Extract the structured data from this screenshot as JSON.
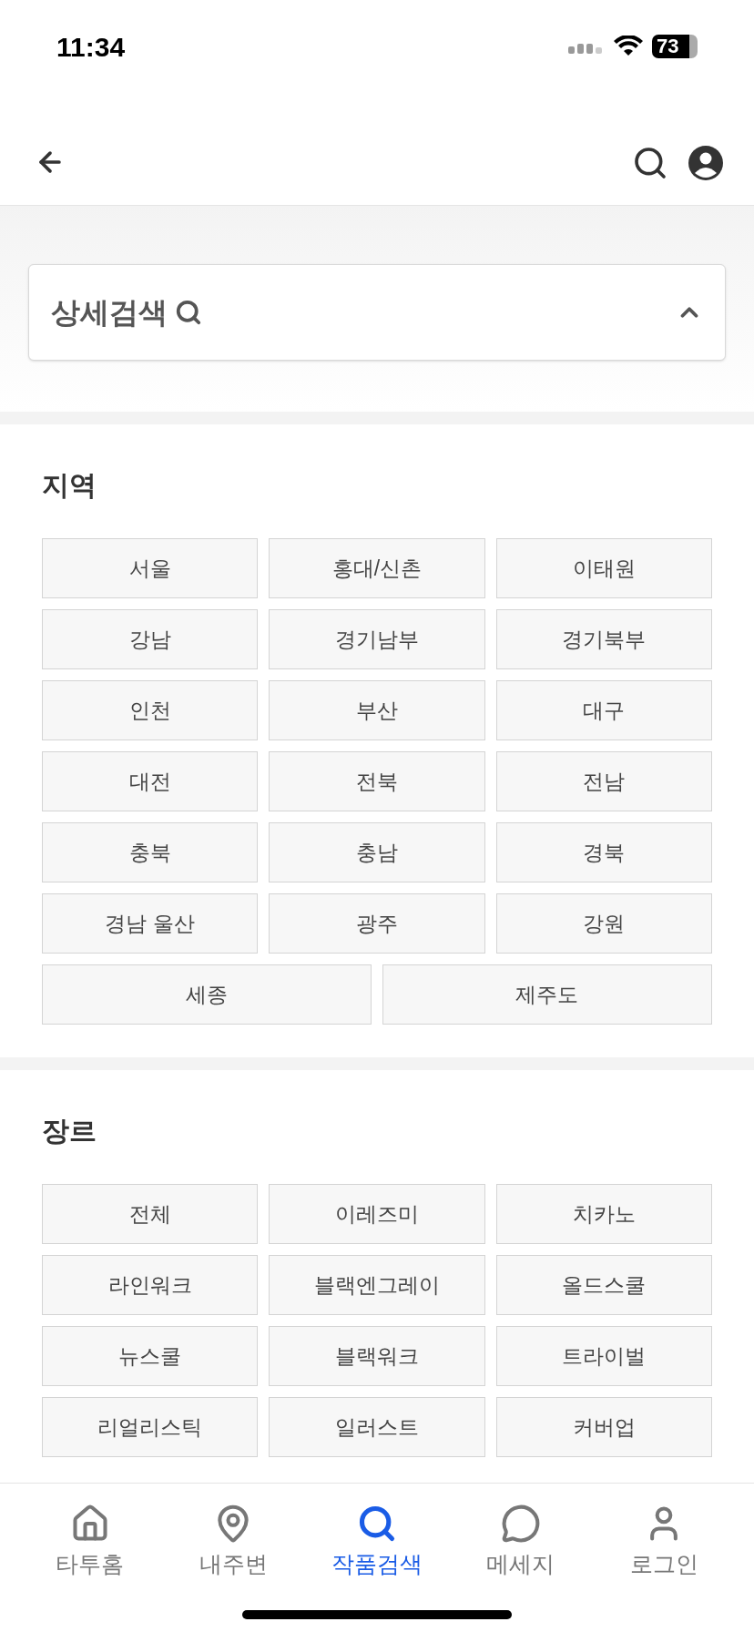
{
  "status_bar": {
    "time": "11:34",
    "battery": "73"
  },
  "filter_card": {
    "title": "상세검색",
    "expanded": true
  },
  "sections": [
    {
      "title": "지역",
      "options": [
        {
          "label": "서울",
          "selected": false
        },
        {
          "label": "홍대/신촌",
          "selected": false
        },
        {
          "label": "이태원",
          "selected": false
        },
        {
          "label": "강남",
          "selected": false
        },
        {
          "label": "경기남부",
          "selected": false
        },
        {
          "label": "경기북부",
          "selected": false
        },
        {
          "label": "인천",
          "selected": false
        },
        {
          "label": "부산",
          "selected": false
        },
        {
          "label": "대구",
          "selected": false
        },
        {
          "label": "대전",
          "selected": false
        },
        {
          "label": "전북",
          "selected": false
        },
        {
          "label": "전남",
          "selected": false
        },
        {
          "label": "충북",
          "selected": false
        },
        {
          "label": "충남",
          "selected": false
        },
        {
          "label": "경북",
          "selected": false
        },
        {
          "label": "경남 울산",
          "selected": false
        },
        {
          "label": "광주",
          "selected": false
        },
        {
          "label": "강원",
          "selected": false
        },
        {
          "label": "세종",
          "selected": false,
          "wide": true
        },
        {
          "label": "제주도",
          "selected": false,
          "wide": true
        }
      ]
    },
    {
      "title": "장르",
      "options": [
        {
          "label": "전체",
          "selected": false
        },
        {
          "label": "이레즈미",
          "selected": false
        },
        {
          "label": "치카노",
          "selected": false
        },
        {
          "label": "라인워크",
          "selected": false
        },
        {
          "label": "블랙엔그레이",
          "selected": false
        },
        {
          "label": "올드스쿨",
          "selected": false
        },
        {
          "label": "뉴스쿨",
          "selected": false
        },
        {
          "label": "블랙워크",
          "selected": false
        },
        {
          "label": "트라이벌",
          "selected": false
        },
        {
          "label": "리얼리스틱",
          "selected": false
        },
        {
          "label": "일러스트",
          "selected": false
        },
        {
          "label": "커버업",
          "selected": false
        }
      ]
    }
  ],
  "tab_bar": [
    {
      "label": "타투홈",
      "kind": "home",
      "selected": false
    },
    {
      "label": "내주변",
      "kind": "pin",
      "selected": false
    },
    {
      "label": "작품검색",
      "kind": "search",
      "selected": true
    },
    {
      "label": "메세지",
      "kind": "chat",
      "selected": false
    },
    {
      "label": "로그인",
      "kind": "person",
      "selected": false
    }
  ]
}
